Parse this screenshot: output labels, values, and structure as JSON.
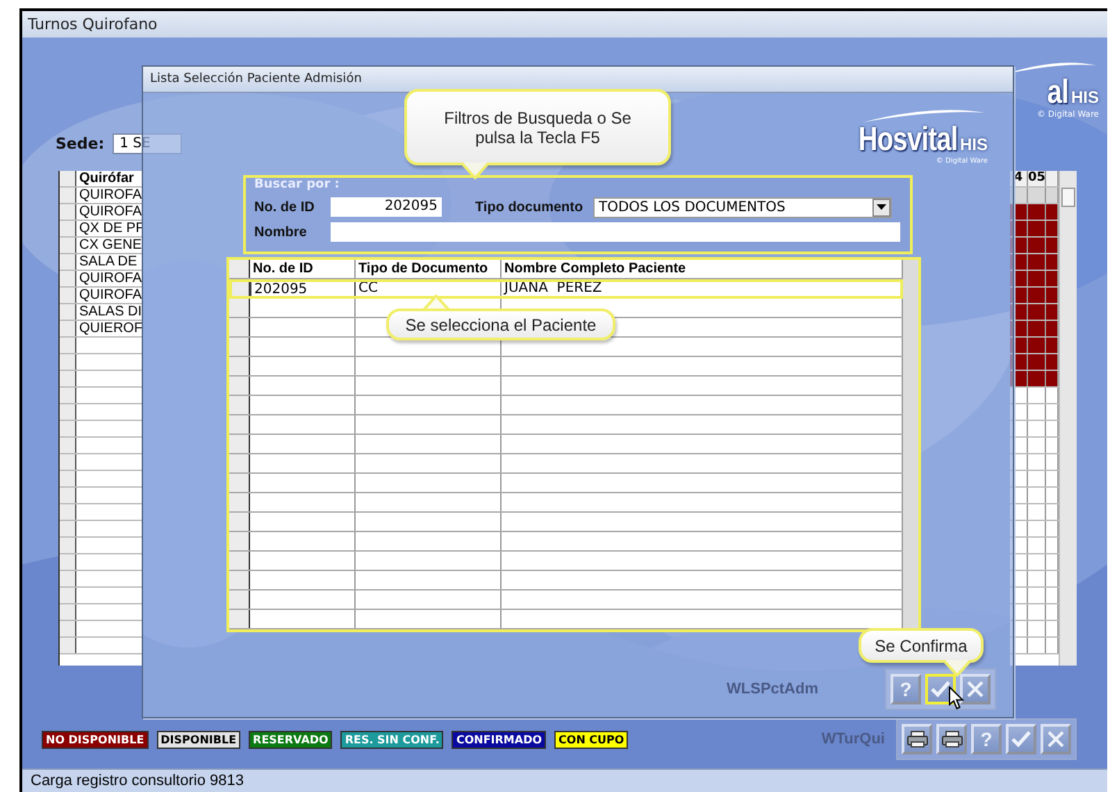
{
  "window": {
    "title": "Turnos Quirofano"
  },
  "sede": {
    "label": "Sede:",
    "value": "1 SE"
  },
  "logo": {
    "name": "al",
    "suffix": "HIS",
    "copyright": "© Digital Ware"
  },
  "room_grid": {
    "header": "Quirófar",
    "rows": [
      "QUIROFA",
      "QUIROFA",
      "QX DE PF",
      "CX GENE",
      "SALA DE",
      "QUIROFA",
      "QUIROFA",
      "SALAS DI",
      "QUIEROF"
    ]
  },
  "schedule_grid": {
    "columns": [
      "4",
      "05"
    ],
    "rows": [
      {
        "color": "#d8d8d8"
      },
      {
        "color": "#8b0000"
      },
      {
        "color": "#8b0000"
      },
      {
        "color": "#8b0000"
      },
      {
        "color": "#8b0000"
      },
      {
        "color": "#8b0000"
      },
      {
        "color": "#8b0000"
      },
      {
        "color": "#8b0000"
      },
      {
        "color": "#8b0000"
      },
      {
        "color": "#8b0000"
      },
      {
        "color": "#8b0000"
      },
      {
        "color": "#8b0000"
      }
    ]
  },
  "legend": [
    {
      "label": "NO DISPONIBLE",
      "color": "#8b0000"
    },
    {
      "label": "DISPONIBLE",
      "color": "#e4e4e4"
    },
    {
      "label": "RESERVADO",
      "color": "#0b7a12"
    },
    {
      "label": "RES. SIN CONF.",
      "color": "#1c9a9c"
    },
    {
      "label": "CONFIRMADO",
      "color": "#0a0aa0"
    },
    {
      "label": "CON CUPO",
      "color": "#ffff00"
    }
  ],
  "main_form_id": "WTurQui",
  "main_buttons": [
    {
      "kind": "print"
    },
    {
      "kind": "print"
    },
    {
      "kind": "help",
      "label": "?"
    },
    {
      "kind": "confirm"
    },
    {
      "kind": "close"
    }
  ],
  "status_bar": "Carga registro consultorio 9813",
  "dialog": {
    "title": "Lista Selección Paciente Admisión",
    "logo": {
      "name": "Hosvital",
      "suffix": "HIS",
      "copyright": "© Digital Ware"
    },
    "search": {
      "legend": "Buscar por :",
      "id_label": "No. de ID",
      "id_value": "202095",
      "doc_label": "Tipo documento",
      "doc_value": "TODOS LOS DOCUMENTOS",
      "name_label": "Nombre"
    },
    "table": {
      "columns": [
        "No. de ID",
        "Tipo de Documento",
        "Nombre Completo Paciente"
      ],
      "rows": [
        {
          "cells": [
            "202095",
            "CC",
            "JUANA  PEREZ"
          ],
          "selected": true
        }
      ]
    },
    "form_id": "WLSPctAdm",
    "buttons": [
      {
        "kind": "help",
        "label": "?",
        "highlighted": false
      },
      {
        "kind": "confirm",
        "highlighted": true
      },
      {
        "kind": "close",
        "highlighted": false
      }
    ]
  },
  "callouts": [
    {
      "text": "Filtros de Busqueda o Se pulsa la Tecla F5"
    },
    {
      "text": "Se selecciona el Paciente"
    },
    {
      "text": "Se Confirma"
    }
  ]
}
